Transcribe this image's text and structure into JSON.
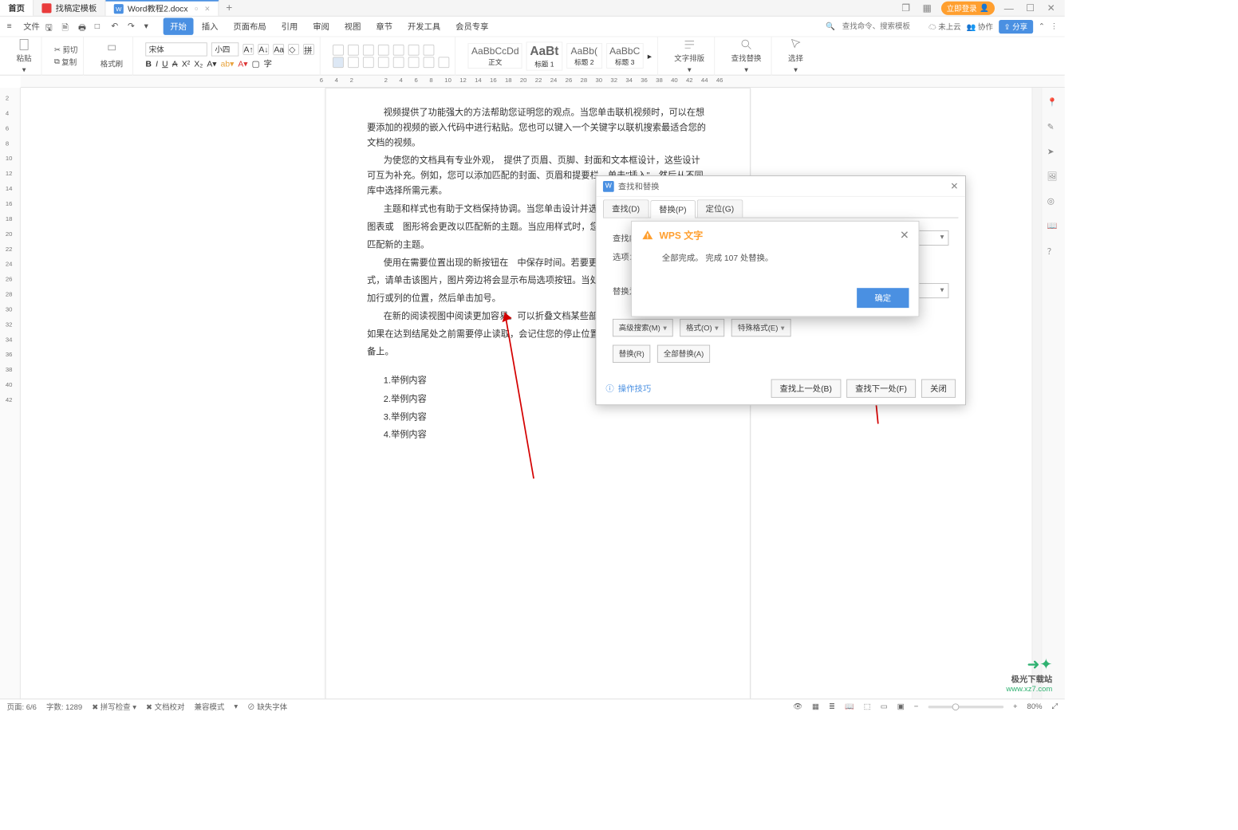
{
  "titlebar": {
    "home_tab": "首页",
    "template_tab": "找稿定模板",
    "doc_tab": "Word教程2.docx",
    "login": "立即登录"
  },
  "menubar": {
    "file": "文件",
    "tabs": [
      "开始",
      "插入",
      "页面布局",
      "引用",
      "审阅",
      "视图",
      "章节",
      "开发工具",
      "会员专享"
    ],
    "active": 0,
    "search_placeholder": "查找命令、搜索模板",
    "cloud": "未上云",
    "collab": "协作",
    "share": "分享"
  },
  "ribbon": {
    "cut": "剪切",
    "copy": "复制",
    "paste": "粘贴",
    "format_painter": "格式刷",
    "font_name": "宋体",
    "font_size": "小四",
    "styles": [
      {
        "preview": "AaBbCcDd",
        "name": "正文"
      },
      {
        "preview": "AaBt",
        "name": "标题 1"
      },
      {
        "preview": "AaBb(",
        "name": "标题 2"
      },
      {
        "preview": "AaBbC",
        "name": "标题 3"
      }
    ],
    "text_layout": "文字排版",
    "find_replace": "查找替换",
    "select": "选择"
  },
  "ruler_top": [
    "6",
    "4",
    "2",
    "2",
    "4",
    "6",
    "8",
    "10",
    "12",
    "14",
    "16",
    "18",
    "20",
    "22",
    "24",
    "26",
    "28",
    "30",
    "32",
    "34",
    "36",
    "38",
    "40",
    "42",
    "44",
    "46"
  ],
  "ruler_left": [
    "2",
    "4",
    "6",
    "8",
    "10",
    "12",
    "14",
    "16",
    "18",
    "20",
    "22",
    "24",
    "26",
    "28",
    "30",
    "32",
    "34",
    "36",
    "38",
    "40",
    "42"
  ],
  "document": {
    "p1": "视频提供了功能强大的方法帮助您证明您的观点。当您单击联机视频时，可以在想要添加的视频的嵌入代码中进行粘贴。您也可以键入一个关键字以联机搜索最适合您的文档的视频。",
    "p2": "为使您的文档具有专业外观，　提供了页眉、页脚、封面和文本框设计，这些设计可互为补充。例如，您可以添加匹配的封面、页眉和提要栏。单击\"插入\"，然后从不同库中选择所需元素。",
    "p3": "主题和样式也有助于文档保持协调。当您单击设计并选择",
    "p3b": "图表或　图形将会更改以匹配新的主题。当应用样式时，您",
    "p3c": "匹配新的主题。",
    "p4": "使用在需要位置出现的新按钮在　中保存时间。若要更",
    "p4b": "式，请单击该图片，图片旁边将会显示布局选项按钮。当处",
    "p4c": "加行或列的位置，然后单击加号。",
    "p5": "在新的阅读视图中阅读更加容易。可以折叠文档某些部",
    "p5b": "如果在达到结尾处之前需要停止读取，会记住您的停止位置",
    "p5c": "备上。",
    "list": [
      "1.举例内容",
      "2.举例内容",
      "3.举例内容",
      "4.举例内容"
    ]
  },
  "find_dialog": {
    "title": "查找和替换",
    "tabs": {
      "find": "查找(D)",
      "replace": "替换(P)",
      "goto": "定位(G)"
    },
    "active_tab": "replace",
    "find_label": "查找内",
    "options_label": "选项：",
    "replace_label": "替换为",
    "adv_search": "高级搜索(M)",
    "format": "格式(O)",
    "special": "特殊格式(E)",
    "replace_btn": "替换(R)",
    "replace_all_btn": "全部替换(A)",
    "tips": "操作技巧",
    "find_prev": "查找上一处(B)",
    "find_next": "查找下一处(F)",
    "close": "关闭"
  },
  "msgbox": {
    "app": "WPS 文字",
    "message": "全部完成。 完成 107 处替换。",
    "ok": "确定"
  },
  "statusbar": {
    "page": "页面: 6/6",
    "words": "字数: 1289",
    "spell": "拼写检查",
    "proof": "文档校对",
    "compat": "兼容模式",
    "missing_fonts": "缺失字体",
    "zoom": "80%"
  },
  "watermark": {
    "l1": "极光下载站",
    "l2": "www.xz7.com"
  }
}
